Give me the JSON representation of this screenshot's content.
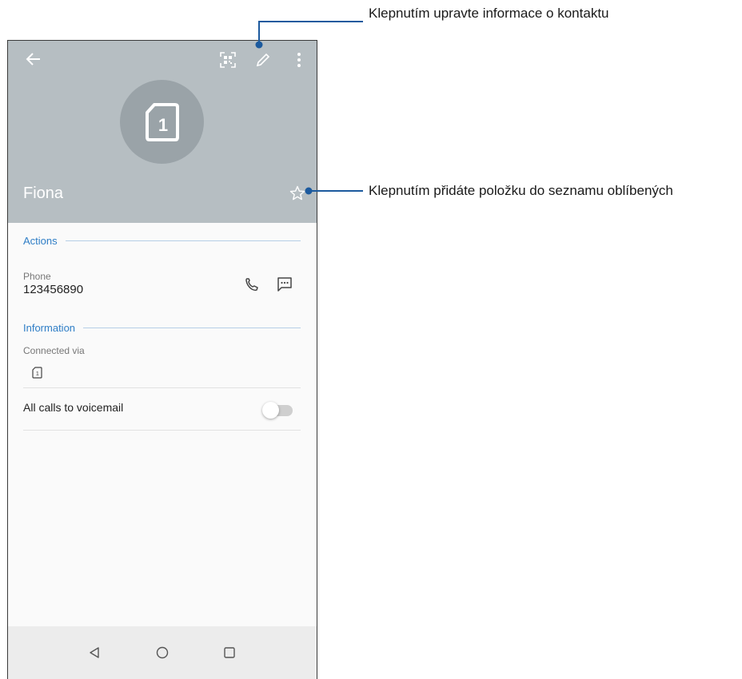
{
  "contact": {
    "name": "Fiona",
    "avatar_icon": "sim-card-1-icon",
    "avatar_glyph": "1"
  },
  "toolbar": {
    "back_icon": "arrow-left-icon",
    "qr_icon": "qr-code-icon",
    "edit_icon": "pencil-icon",
    "more_icon": "more-vertical-icon"
  },
  "favorite": {
    "icon": "star-outline-icon"
  },
  "actions": {
    "section_label": "Actions",
    "phone_label": "Phone",
    "phone_number": "123456890",
    "call_icon": "phone-icon",
    "message_icon": "message-icon"
  },
  "information": {
    "section_label": "Information",
    "connected_via_label": "Connected via",
    "sim_glyph": "1",
    "voicemail_label": "All calls to voicemail",
    "voicemail_enabled": false
  },
  "navbar": {
    "back_icon": "triangle-back-icon",
    "home_icon": "circle-home-icon",
    "recents_icon": "square-recents-icon"
  },
  "callouts": [
    {
      "text": "Klepnutím upravte informace o kontaktu"
    },
    {
      "text": "Klepnutím přidáte položku do seznamu oblíbených"
    }
  ],
  "colors": {
    "header_bg": "#b6bec2",
    "avatar_bg": "#9aa3a8",
    "accent": "#2f7ec6",
    "callout_line": "#1c5a9e"
  }
}
